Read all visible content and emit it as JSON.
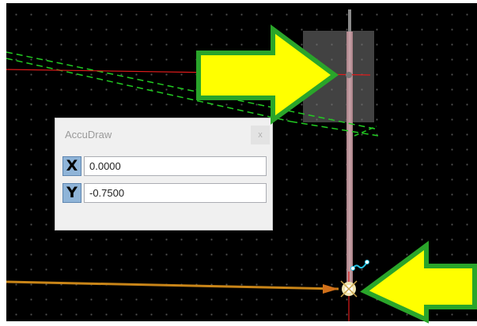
{
  "accudraw": {
    "title": "AccuDraw",
    "close_glyph": "x",
    "x_label": "X",
    "x_value": "0.0000",
    "y_label": "Y",
    "y_value": "-0.7500"
  },
  "colors": {
    "canvas_background": "#000000",
    "grid_dots": "#4f4f4f",
    "green_dashed_line": "#22cc22",
    "red_axis_line": "#e01b1b",
    "orange_element_line": "#d08a1a",
    "callout_arrow_fill": "#ffff00",
    "callout_arrow_outline": "#2aa52a",
    "cursor_cyan": "#27c6e6"
  },
  "icons": {
    "top_arrow": "arrow-right-icon",
    "bottom_arrow": "arrow-left-icon",
    "snap_point": "snap-point-icon",
    "curve_cursor": "accudraw-compass-icon"
  }
}
